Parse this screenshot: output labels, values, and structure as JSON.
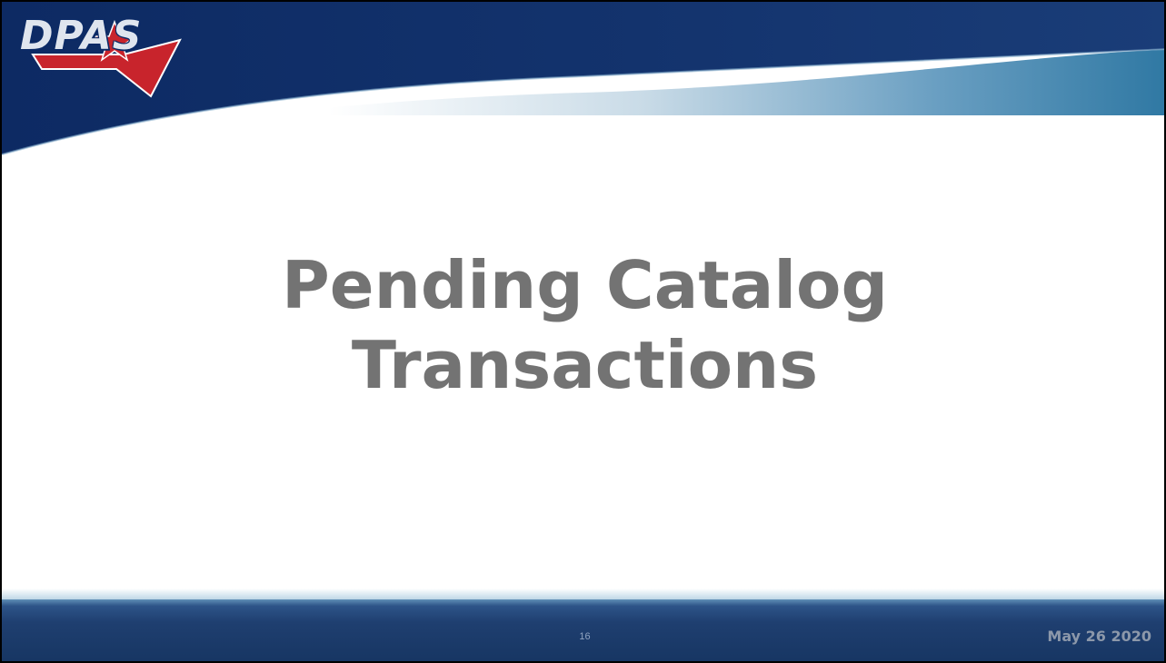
{
  "logo": {
    "text": "DPAS",
    "icon": "star-chevron-icon"
  },
  "slide": {
    "title_line1": "Pending Catalog",
    "title_line2": "Transactions",
    "number": "16",
    "date": "May 26 2020"
  },
  "colors": {
    "header_dark": "#0f2c66",
    "header_light": "#3b82a8",
    "title_text": "#737373",
    "footer": "#1f3f70",
    "logo_red": "#c8242c"
  }
}
